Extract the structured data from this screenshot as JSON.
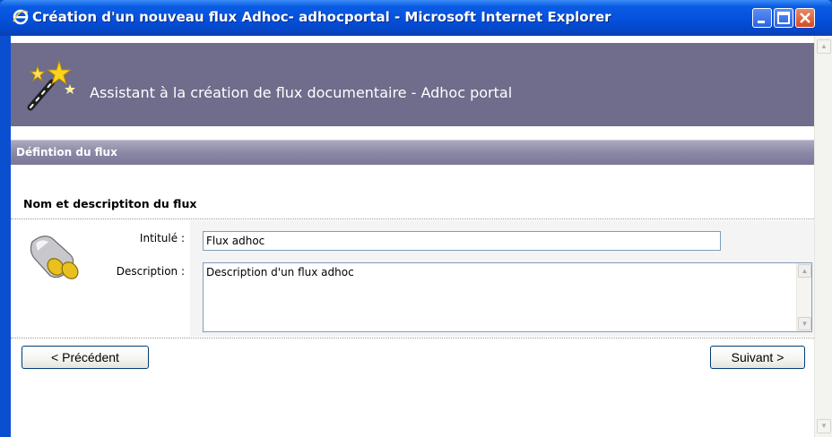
{
  "window": {
    "title": "Création d'un nouveau flux Adhoc- adhocportal - Microsoft Internet Explorer",
    "icon": "ie-icon",
    "controls": {
      "minimize_icon": "minimize-icon",
      "maximize_icon": "maximize-icon",
      "close_icon": "close-icon"
    }
  },
  "banner": {
    "icon": "magic-wand-icon",
    "title": "Assistant à la création de flux documentaire - Adhoc portal"
  },
  "section": {
    "title": "Défintion du flux"
  },
  "subsection": {
    "title": "Nom et descriptiton du flux",
    "icon": "plug-icon"
  },
  "form": {
    "intitule_label": "Intitulé :",
    "intitule_value": "Flux adhoc",
    "description_label": "Description :",
    "description_value": "Description d'un flux adhoc"
  },
  "buttons": {
    "previous": "< Précédent",
    "next": "Suivant >"
  },
  "colors": {
    "titlebar": "#0550dc",
    "banner": "#6f6c8c",
    "section_bar": "#8a88a6"
  }
}
